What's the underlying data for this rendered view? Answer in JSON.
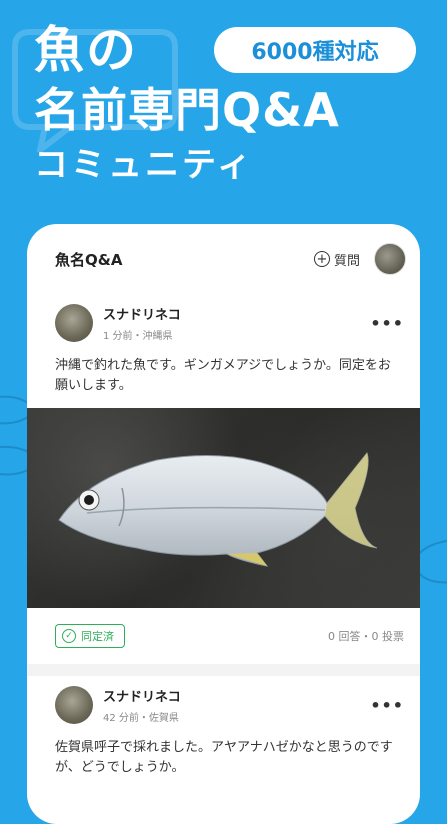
{
  "hero": {
    "line1": "魚の",
    "line2": "名前専門Q&A",
    "line3": "コミュニティ",
    "badge": "6000種対応"
  },
  "app": {
    "title": "魚名Q&A",
    "ask_label": "質問",
    "plus_icon": "plus-circle-icon",
    "avatar_icon": "user-avatar"
  },
  "posts": [
    {
      "user": "スナドリネコ",
      "meta": "1 分前・沖縄県",
      "text": "沖縄で釣れた魚です。ギンガメアジでしょうか。同定をお願いします。",
      "status": "同定済",
      "stats": "0 回答・0 投票",
      "more": "•••"
    },
    {
      "user": "スナドリネコ",
      "meta": "42 分前・佐賀県",
      "text": "佐賀県呼子で採れました。アヤアナハゼかなと思うのですが、どうでしょうか。",
      "more": "•••"
    }
  ],
  "colors": {
    "background": "#26a5e8",
    "verified": "#2fae5a",
    "badge_text": "#1b8fd8"
  }
}
